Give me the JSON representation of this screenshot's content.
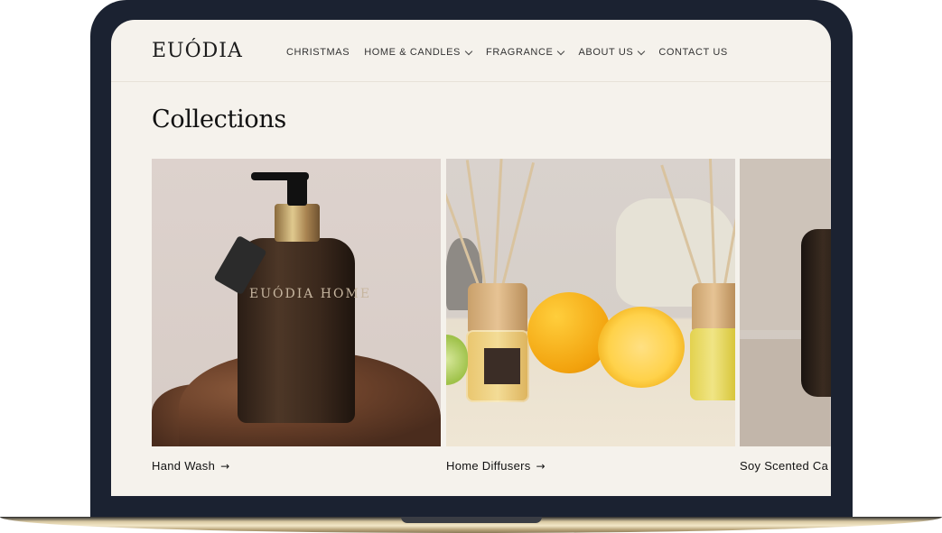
{
  "brand": {
    "logo_text": "EUÓDIA"
  },
  "nav": {
    "items": [
      {
        "label": "CHRISTMAS",
        "dropdown": false
      },
      {
        "label": "HOME & CANDLES",
        "dropdown": true
      },
      {
        "label": "FRAGRANCE",
        "dropdown": true
      },
      {
        "label": "ABOUT US",
        "dropdown": true
      },
      {
        "label": "CONTACT US",
        "dropdown": false
      }
    ]
  },
  "main": {
    "title": "Collections",
    "collections": [
      {
        "label": "Hand Wash",
        "arrow": "→",
        "product_text": "EUÓDIA HOME"
      },
      {
        "label": "Home Diffusers",
        "arrow": "→"
      },
      {
        "label": "Soy Scented Ca",
        "arrow": ""
      }
    ]
  },
  "colors": {
    "page_background": "#f5f2ec",
    "bezel": "#1b2231",
    "text": "#111111"
  }
}
